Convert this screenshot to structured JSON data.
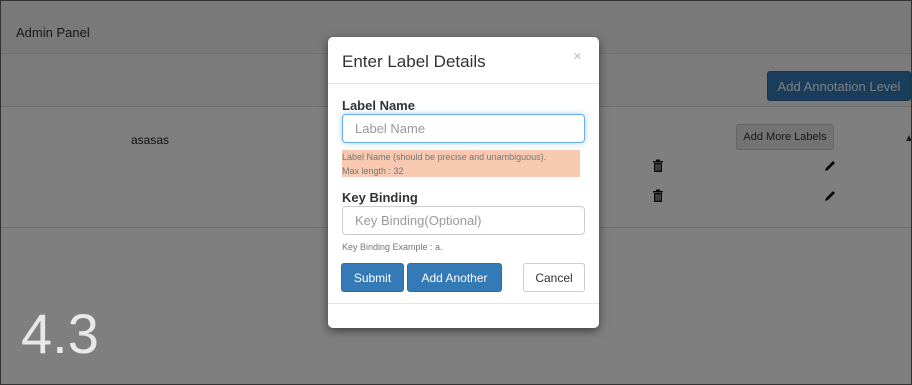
{
  "panel": {
    "title": "Admin Panel"
  },
  "toolbar": {
    "add_annotation_level": "Add Annotation Level"
  },
  "label_row": {
    "name": "asasas",
    "add_more_labels": "Add More Labels"
  },
  "version": "4.3",
  "modal": {
    "title": "Enter Label Details",
    "close_glyph": "×",
    "label_name": {
      "label": "Label Name",
      "placeholder": "Label Name",
      "help_1": "Label Name (should be precise and unambiguous).",
      "help_2": "Max length : 32"
    },
    "key_binding": {
      "label": "Key Binding",
      "placeholder": "Key Binding(Optional)",
      "help": "Key Binding Example : a."
    },
    "buttons": {
      "submit": "Submit",
      "add_another": "Add Another",
      "cancel": "Cancel"
    }
  },
  "colors": {
    "primary": "#337ab7",
    "overlay": "rgba(0,0,0,0.5)",
    "highlight": "#f7c9b0"
  },
  "icons": [
    "trash-icon",
    "pencil-icon",
    "close-icon",
    "caret-up-icon"
  ]
}
